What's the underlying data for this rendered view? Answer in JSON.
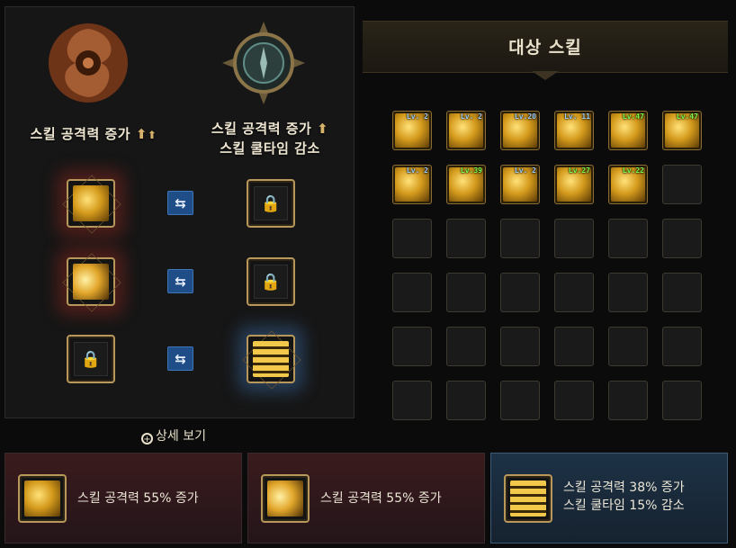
{
  "left_panel": {
    "emblem_a": "swirl-emblem-icon",
    "emblem_b": "compass-emblem-icon",
    "label_a": "스킬 공격력 증가",
    "label_b_line1": "스킬 공격력 증가",
    "label_b_line2": "스킬 쿨타임 감소",
    "arrow": "⬆",
    "rows": [
      {
        "left_icon": "vortex-skill-icon",
        "right_icon": "lock-icon"
      },
      {
        "left_icon": "slash-skill-icon",
        "right_icon": "lock-icon"
      },
      {
        "left_icon": "lock-icon",
        "right_icon": "wind-skill-icon"
      }
    ],
    "swap_glyph": "⇆"
  },
  "detail_link": "상세 보기",
  "right_panel": {
    "title": "대상 스킬",
    "skills": [
      {
        "level": "Lv. 2",
        "high": false
      },
      {
        "level": "Lv. 2",
        "high": false
      },
      {
        "level": "Lv.20",
        "high": false
      },
      {
        "level": "Lv. 11",
        "high": false
      },
      {
        "level": "Lv.47",
        "high": true
      },
      {
        "level": "Lv.47",
        "high": true
      },
      {
        "level": "Lv. 2",
        "high": false
      },
      {
        "level": "Lv.39",
        "high": true
      },
      {
        "level": "Lv. 2",
        "high": false
      },
      {
        "level": "Lv.27",
        "high": true
      },
      {
        "level": "Lv.22",
        "high": true
      }
    ]
  },
  "bottom": [
    {
      "icon": "vortex-skill-icon",
      "line1": "스킬 공격력 55% 증가",
      "line2": ""
    },
    {
      "icon": "slash-skill-icon",
      "line1": "스킬 공격력 55% 증가",
      "line2": ""
    },
    {
      "icon": "wind-skill-icon",
      "line1": "스킬 공격력 38% 증가",
      "line2": "스킬 쿨타임 15% 감소"
    }
  ],
  "colors": {
    "accent_gold": "#b8975a",
    "swap_blue": "#1e4d87",
    "level_blue": "#9fd0ff",
    "level_green": "#7cff4a"
  }
}
